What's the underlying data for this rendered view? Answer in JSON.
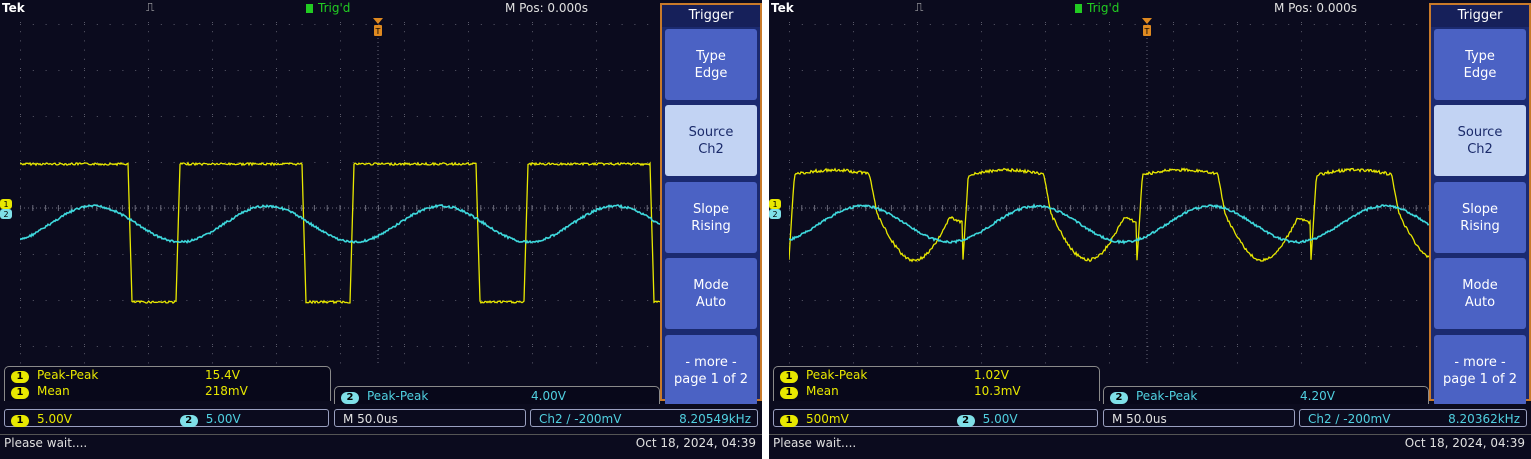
{
  "screens": [
    {
      "top": {
        "brand": "Tek",
        "acq_symbol": "⎍",
        "trig_status": "Trig'd",
        "mpos": "M Pos: 0.000s"
      },
      "menu": {
        "title": "Trigger",
        "buttons": [
          {
            "l1": "Type",
            "l2": "Edge",
            "selected": false
          },
          {
            "l1": "Source",
            "l2": "Ch2",
            "selected": true
          },
          {
            "l1": "Slope",
            "l2": "Rising",
            "selected": false
          },
          {
            "l1": "Mode",
            "l2": "Auto",
            "selected": false
          },
          {
            "l1": "- more -",
            "l2": "page 1 of 2",
            "selected": false
          }
        ]
      },
      "measurements": {
        "ch1": [
          {
            "badge": "1",
            "label": "Peak-Peak",
            "value": "15.4V"
          },
          {
            "badge": "1",
            "label": "Mean",
            "value": "218mV"
          }
        ],
        "ch2": {
          "badge": "2",
          "label": "Peak-Peak",
          "value": "4.00V"
        }
      },
      "status": {
        "ch1_badge": "1",
        "ch1_scale": "5.00V",
        "ch2_badge": "2",
        "ch2_scale": "5.00V",
        "timebase": "M 50.0us",
        "trigger": "Ch2 ∕ -200mV",
        "frequency": "8.20549kHz"
      },
      "message": "Please wait....",
      "datetime": "Oct 18, 2024, 04:39",
      "waveforms": {
        "ch1_shape": "square",
        "ch2_shape": "sine"
      },
      "colors": {
        "ch1": "#e8e800",
        "ch2": "#3ed8dc"
      }
    },
    {
      "top": {
        "brand": "Tek",
        "acq_symbol": "⎍",
        "trig_status": "Trig'd",
        "mpos": "M Pos: 0.000s"
      },
      "menu": {
        "title": "Trigger",
        "buttons": [
          {
            "l1": "Type",
            "l2": "Edge",
            "selected": false
          },
          {
            "l1": "Source",
            "l2": "Ch2",
            "selected": true
          },
          {
            "l1": "Slope",
            "l2": "Rising",
            "selected": false
          },
          {
            "l1": "Mode",
            "l2": "Auto",
            "selected": false
          },
          {
            "l1": "- more -",
            "l2": "page 1 of 2",
            "selected": false
          }
        ]
      },
      "measurements": {
        "ch1": [
          {
            "badge": "1",
            "label": "Peak-Peak",
            "value": "1.02V"
          },
          {
            "badge": "1",
            "label": "Mean",
            "value": "10.3mV"
          }
        ],
        "ch2": {
          "badge": "2",
          "label": "Peak-Peak",
          "value": "4.20V"
        }
      },
      "status": {
        "ch1_badge": "1",
        "ch1_scale": "500mV",
        "ch2_badge": "2",
        "ch2_scale": "5.00V",
        "timebase": "M 50.0us",
        "trigger": "Ch2 ∕ -200mV",
        "frequency": "8.20362kHz"
      },
      "message": "Please wait....",
      "datetime": "Oct 18, 2024, 04:39",
      "waveforms": {
        "ch1_shape": "rc-filtered square",
        "ch2_shape": "sine"
      },
      "colors": {
        "ch1": "#e8e800",
        "ch2": "#3ed8dc"
      }
    }
  ]
}
